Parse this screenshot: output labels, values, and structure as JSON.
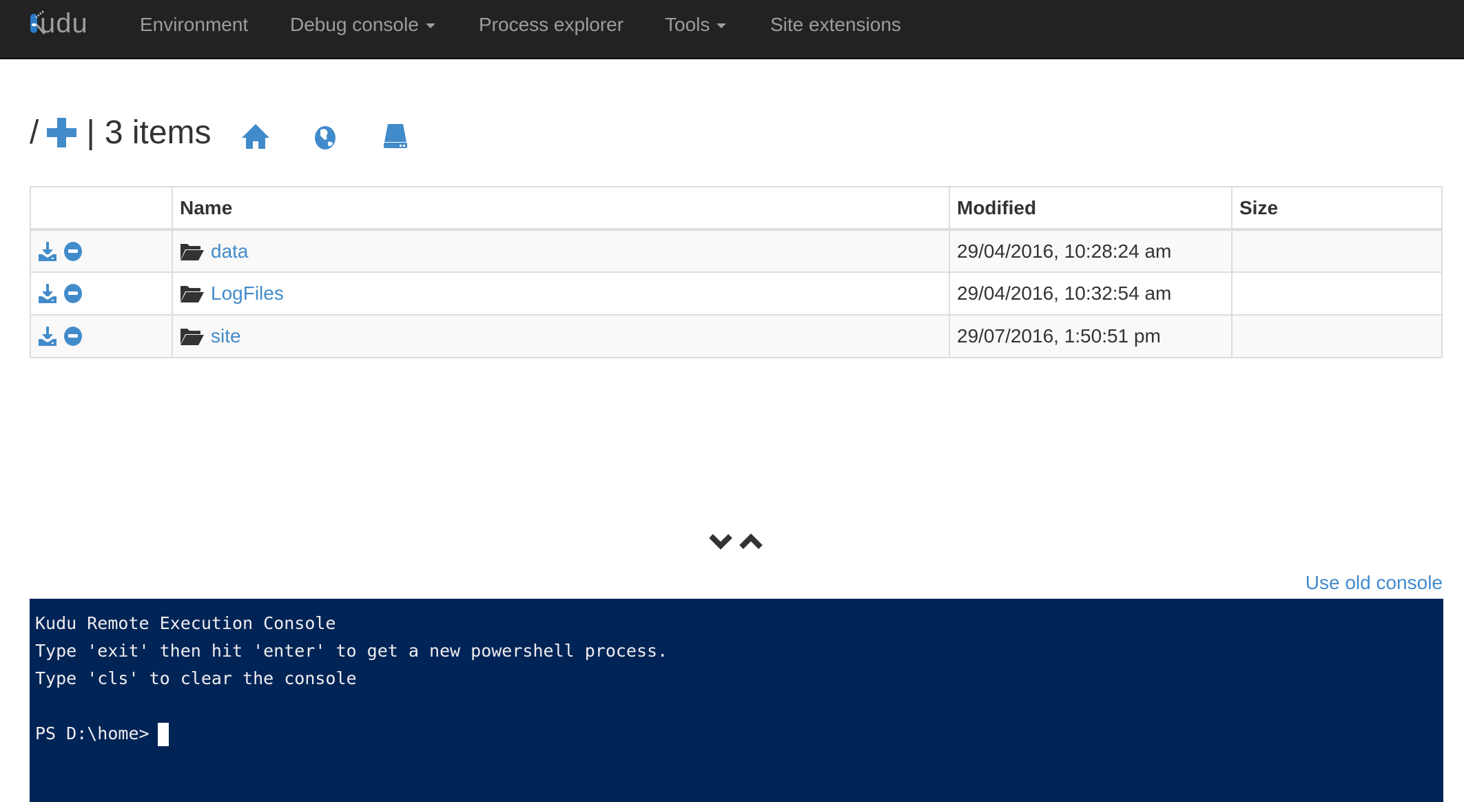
{
  "navbar": {
    "brand": "udu",
    "items": [
      {
        "label": "Environment",
        "has_dropdown": false
      },
      {
        "label": "Debug console",
        "has_dropdown": true
      },
      {
        "label": "Process explorer",
        "has_dropdown": false
      },
      {
        "label": "Tools",
        "has_dropdown": true
      },
      {
        "label": "Site extensions",
        "has_dropdown": false
      }
    ]
  },
  "header": {
    "path": "/",
    "separator": "|",
    "item_count": "3 items",
    "icons": [
      "add-icon",
      "home-icon",
      "globe-icon",
      "drive-icon"
    ]
  },
  "table": {
    "columns": [
      "",
      "Name",
      "Modified",
      "Size"
    ],
    "rows": [
      {
        "name": "data",
        "modified": "29/04/2016, 10:28:24 am",
        "size": ""
      },
      {
        "name": "LogFiles",
        "modified": "29/04/2016, 10:32:54 am",
        "size": ""
      },
      {
        "name": "site",
        "modified": "29/07/2016, 1:50:51 pm",
        "size": ""
      }
    ]
  },
  "old_console_link": "Use old console",
  "console": {
    "lines": [
      "Kudu Remote Execution Console",
      "Type 'exit' then hit 'enter' to get a new powershell process.",
      "Type 'cls' to clear the console",
      "",
      "PS D:\\home>"
    ]
  },
  "colors": {
    "navbar_bg": "#222222",
    "accent": "#428bca",
    "console_bg": "#012456"
  }
}
